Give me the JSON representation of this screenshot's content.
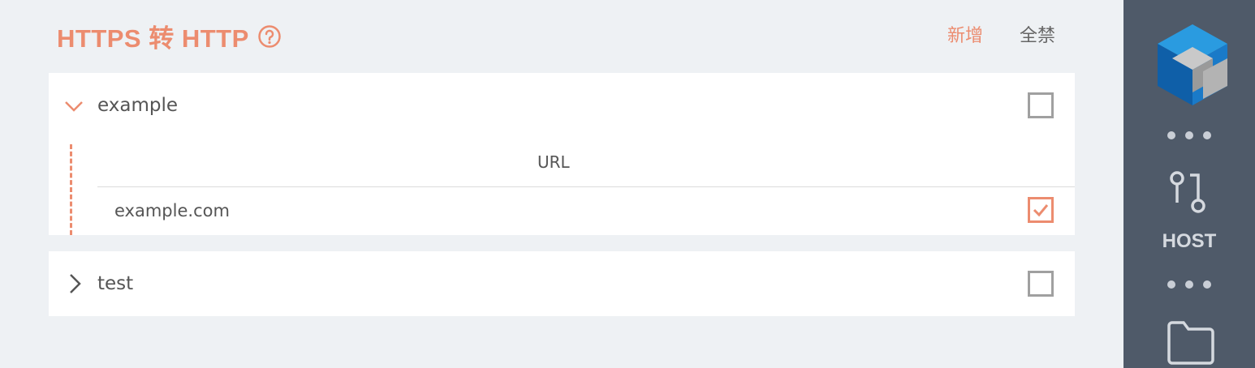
{
  "header": {
    "title": "HTTPS 转 HTTP",
    "help_icon": "question-circle-icon",
    "add_label": "新增",
    "disable_all_label": "全禁"
  },
  "groups": [
    {
      "name": "example",
      "expanded": true,
      "enabled_checked": false,
      "column_header": "URL",
      "rows": [
        {
          "url": "example.com",
          "checked": true
        }
      ]
    },
    {
      "name": "test",
      "expanded": false,
      "enabled_checked": false
    }
  ],
  "sidebar": {
    "logo_icon": "cube-logo-icon",
    "host_icon": "git-branch-icon",
    "host_label": "HOST",
    "folder_icon": "folder-icon"
  },
  "colors": {
    "accent": "#ec8c6f",
    "sidebar_bg": "#4f5a69",
    "page_bg": "#eef1f4"
  }
}
